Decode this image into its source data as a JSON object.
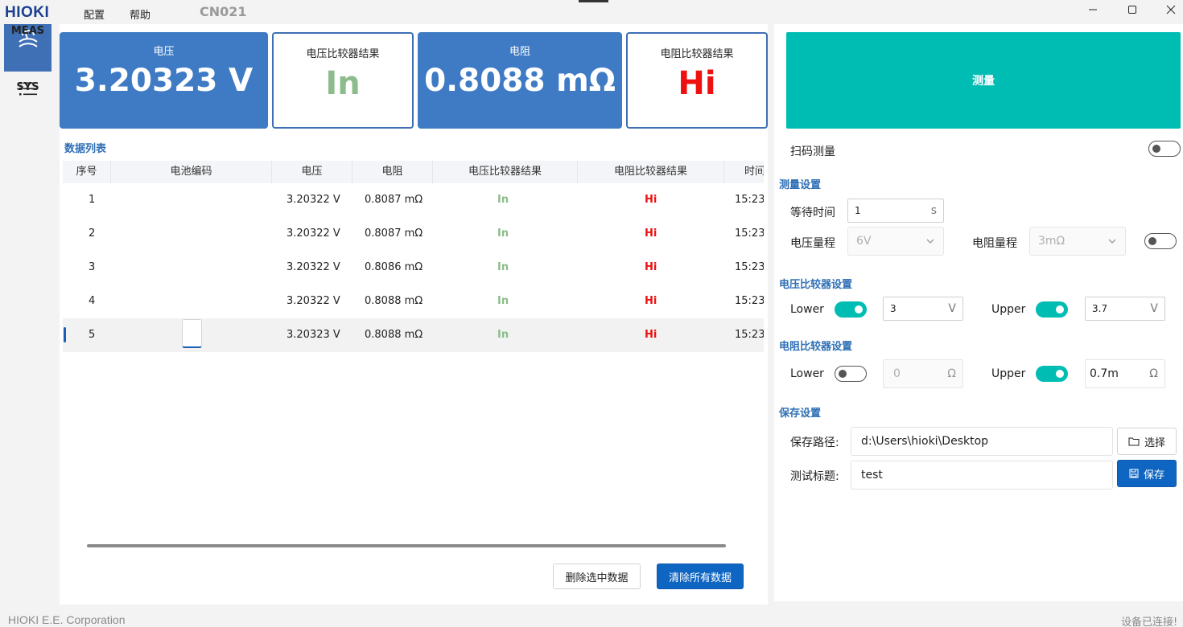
{
  "app": {
    "logo": "HIOKI",
    "menu": [
      "配置",
      "帮助"
    ],
    "model": "CN021"
  },
  "nav": {
    "meas_label": "MEAS",
    "sys_label": "SYS"
  },
  "cards": {
    "voltage_caption": "电压",
    "voltage_value": "3.20323 V",
    "voltage_result_caption": "电压比较器结果",
    "voltage_result_value": "In",
    "resistance_caption": "电阻",
    "resistance_value": "0.8088 mΩ",
    "resistance_result_caption": "电阻比较器结果",
    "resistance_result_value": "Hi"
  },
  "colors": {
    "in_green": "#8cbc8c",
    "hi_red": "#ee1111",
    "accent_teal": "#00bdb4",
    "primary_blue": "#0f66c2"
  },
  "data_list": {
    "title": "数据列表",
    "columns": [
      "序号",
      "电池编码",
      "电压",
      "电阻",
      "电压比较器结果",
      "电阻比较器结果",
      "时间"
    ],
    "rows": [
      {
        "no": "1",
        "code": "",
        "voltage": "3.20322 V",
        "resistance": "0.8087 mΩ",
        "v_result": "In",
        "r_result": "Hi",
        "time": "15:23"
      },
      {
        "no": "2",
        "code": "",
        "voltage": "3.20322 V",
        "resistance": "0.8087 mΩ",
        "v_result": "In",
        "r_result": "Hi",
        "time": "15:23"
      },
      {
        "no": "3",
        "code": "",
        "voltage": "3.20322 V",
        "resistance": "0.8086 mΩ",
        "v_result": "In",
        "r_result": "Hi",
        "time": "15:23"
      },
      {
        "no": "4",
        "code": "",
        "voltage": "3.20322 V",
        "resistance": "0.8088 mΩ",
        "v_result": "In",
        "r_result": "Hi",
        "time": "15:23"
      },
      {
        "no": "5",
        "code": "",
        "voltage": "3.20323 V",
        "resistance": "0.8088 mΩ",
        "v_result": "In",
        "r_result": "Hi",
        "time": "15:23"
      }
    ],
    "selected_row": 5,
    "delete_selected_label": "删除选中数据",
    "clear_all_label": "清除所有数据"
  },
  "right": {
    "measure_label": "测量",
    "scan_label": "扫码测量",
    "scan_enabled": false,
    "measure_settings_title": "测量设置",
    "wait_time_label": "等待时间",
    "wait_time_value": "1",
    "wait_time_unit": "s",
    "voltage_range_label": "电压量程",
    "voltage_range_value": "6V",
    "resistance_range_label": "电阻量程",
    "resistance_range_value": "3mΩ",
    "range_toggle_enabled": false,
    "v_comp_title": "电压比较器设置",
    "v_lower_label": "Lower",
    "v_lower_enabled": true,
    "v_lower_value": "3",
    "v_unit": "V",
    "v_upper_label": "Upper",
    "v_upper_enabled": true,
    "v_upper_value": "3.7",
    "r_comp_title": "电阻比较器设置",
    "r_lower_label": "Lower",
    "r_lower_enabled": false,
    "r_lower_value": "0",
    "r_unit": "Ω",
    "r_upper_label": "Upper",
    "r_upper_enabled": true,
    "r_upper_value": "0.7m",
    "save_settings_title": "保存设置",
    "save_path_label": "保存路径:",
    "save_path_value": "d:\\Users\\hioki\\Desktop",
    "choose_label": "选择",
    "test_title_label": "测试标题:",
    "test_title_value": "test",
    "save_label": "保存"
  },
  "footer": {
    "company": "HIOKI E.E. Corporation",
    "status": "设备已连接!"
  }
}
